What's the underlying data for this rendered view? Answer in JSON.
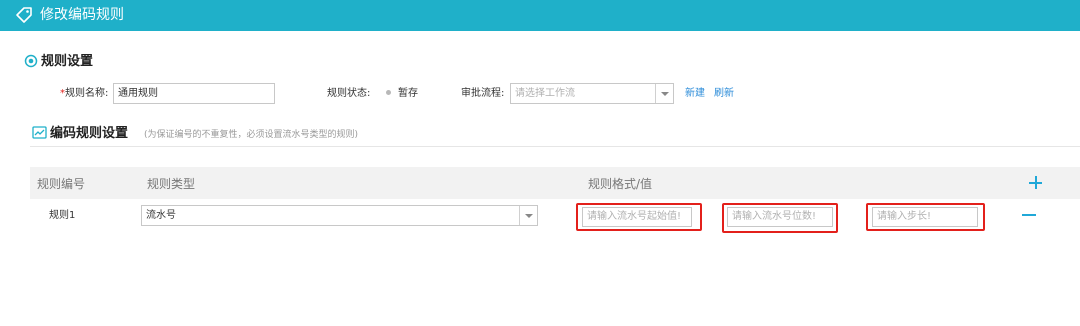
{
  "header": {
    "title": "修改编码规则",
    "icon": "tag-icon",
    "bg_color": "#1fb0c9"
  },
  "rule_settings": {
    "section_title": "规则设置",
    "name_required_mark": "*",
    "name_label": "规则名称:",
    "name_value": "通用规则",
    "status_label": "规则状态:",
    "status_value": "暂存",
    "approval_label": "审批流程:",
    "approval_placeholder": "请选择工作流",
    "new_link": "新建",
    "refresh_link": "刷新"
  },
  "encoding_settings": {
    "section_title": "编码规则设置",
    "hint": "(为保证编号的不重复性，必须设置流水号类型的规则)"
  },
  "table": {
    "columns": [
      "规则编号",
      "规则类型",
      "规则格式/值"
    ],
    "rows": [
      {
        "rule_no": "规则1",
        "rule_type": "流水号",
        "start_placeholder": "请输入流水号起始值!",
        "digits_placeholder": "请输入流水号位数!",
        "step_placeholder": "请输入步长!"
      }
    ]
  },
  "colors": {
    "accent": "#1fb0c9",
    "link": "#2c8cd9",
    "highlight": "#e3201b",
    "required": "#e0201b"
  }
}
